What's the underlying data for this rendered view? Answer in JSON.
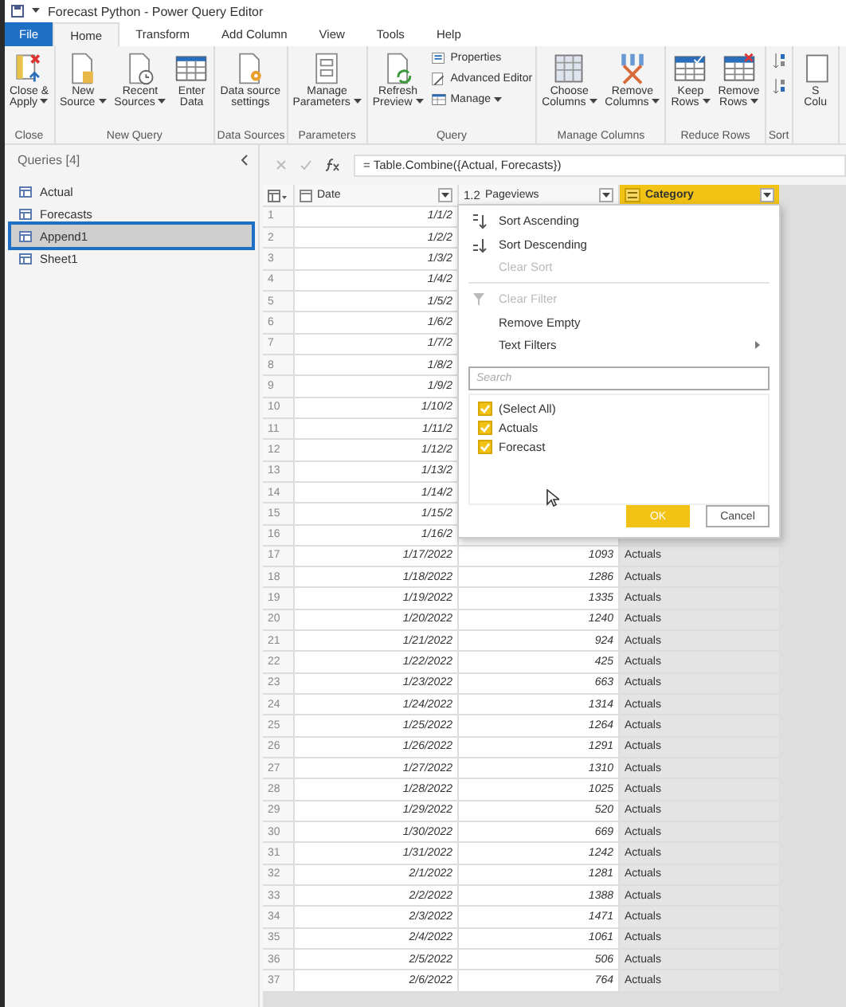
{
  "window": {
    "title": "Forecast Python - Power Query Editor"
  },
  "tabs": [
    {
      "label": "File",
      "kind": "file",
      "selected": false
    },
    {
      "label": "Home",
      "kind": "tab",
      "selected": true
    },
    {
      "label": "Transform",
      "kind": "tab",
      "selected": false
    },
    {
      "label": "Add Column",
      "kind": "tab",
      "selected": false
    },
    {
      "label": "View",
      "kind": "tab",
      "selected": false
    },
    {
      "label": "Tools",
      "kind": "tab",
      "selected": false
    },
    {
      "label": "Help",
      "kind": "tab",
      "selected": false
    }
  ],
  "ribbon": [
    {
      "group": "Close",
      "buttons": [
        {
          "kind": "large",
          "label": "Close &\nApply",
          "dropdown": true
        }
      ]
    },
    {
      "group": "New Query",
      "buttons": [
        {
          "kind": "large",
          "label": "New\nSource",
          "dropdown": true
        },
        {
          "kind": "large",
          "label": "Recent\nSources",
          "dropdown": true
        },
        {
          "kind": "large",
          "label": "Enter\nData",
          "dropdown": false
        }
      ]
    },
    {
      "group": "Data Sources",
      "buttons": [
        {
          "kind": "large",
          "label": "Data source\nsettings",
          "dropdown": false
        }
      ]
    },
    {
      "group": "Parameters",
      "buttons": [
        {
          "kind": "large",
          "label": "Manage\nParameters",
          "dropdown": true
        }
      ]
    },
    {
      "group": "Query",
      "buttons": [
        {
          "kind": "large",
          "label": "Refresh\nPreview",
          "dropdown": true
        },
        {
          "kind": "small",
          "label": "Properties",
          "dropdown": false
        },
        {
          "kind": "small",
          "label": "Advanced Editor",
          "dropdown": false
        },
        {
          "kind": "small",
          "label": "Manage",
          "dropdown": true
        }
      ]
    },
    {
      "group": "Manage Columns",
      "buttons": [
        {
          "kind": "large",
          "label": "Choose\nColumns",
          "dropdown": true
        },
        {
          "kind": "large",
          "label": "Remove\nColumns",
          "dropdown": true
        }
      ]
    },
    {
      "group": "Reduce Rows",
      "buttons": [
        {
          "kind": "large",
          "label": "Keep\nRows",
          "dropdown": true
        },
        {
          "kind": "large",
          "label": "Remove\nRows",
          "dropdown": true
        }
      ]
    },
    {
      "group": "Sort",
      "buttons": [
        {
          "kind": "icon"
        },
        {
          "kind": "icon"
        }
      ]
    },
    {
      "buttons": [
        {
          "kind": "large",
          "label": "S\nColu",
          "dropdown": false
        }
      ]
    }
  ],
  "queries": {
    "title": "Queries [4]",
    "items": [
      {
        "label": "Actual",
        "selected": false
      },
      {
        "label": "Forecasts",
        "selected": false
      },
      {
        "label": "Append1",
        "selected": true
      },
      {
        "label": "Sheet1",
        "selected": false
      }
    ]
  },
  "formula": {
    "text": "= Table.Combine({Actual, Forecasts})"
  },
  "grid": {
    "columns": [
      {
        "label": "Date",
        "kind": "date",
        "selected": false
      },
      {
        "label": "Pageviews",
        "kind": "number",
        "type": "1.2",
        "selected": false
      },
      {
        "label": "Category",
        "kind": "text",
        "selected": true
      }
    ],
    "rows": [
      {
        "n": "1",
        "date": "1/1/2"
      },
      {
        "n": "2",
        "date": "1/2/2"
      },
      {
        "n": "3",
        "date": "1/3/2"
      },
      {
        "n": "4",
        "date": "1/4/2"
      },
      {
        "n": "5",
        "date": "1/5/2"
      },
      {
        "n": "6",
        "date": "1/6/2"
      },
      {
        "n": "7",
        "date": "1/7/2"
      },
      {
        "n": "8",
        "date": "1/8/2"
      },
      {
        "n": "9",
        "date": "1/9/2"
      },
      {
        "n": "10",
        "date": "1/10/2"
      },
      {
        "n": "11",
        "date": "1/11/2"
      },
      {
        "n": "12",
        "date": "1/12/2"
      },
      {
        "n": "13",
        "date": "1/13/2"
      },
      {
        "n": "14",
        "date": "1/14/2"
      },
      {
        "n": "15",
        "date": "1/15/2"
      },
      {
        "n": "16",
        "date": "1/16/2"
      },
      {
        "n": "17",
        "date": "1/17/2022",
        "pageviews": "1093",
        "category": "Actuals"
      },
      {
        "n": "18",
        "date": "1/18/2022",
        "pageviews": "1286",
        "category": "Actuals"
      },
      {
        "n": "19",
        "date": "1/19/2022",
        "pageviews": "1335",
        "category": "Actuals"
      },
      {
        "n": "20",
        "date": "1/20/2022",
        "pageviews": "1240",
        "category": "Actuals"
      },
      {
        "n": "21",
        "date": "1/21/2022",
        "pageviews": "924",
        "category": "Actuals"
      },
      {
        "n": "22",
        "date": "1/22/2022",
        "pageviews": "425",
        "category": "Actuals"
      },
      {
        "n": "23",
        "date": "1/23/2022",
        "pageviews": "663",
        "category": "Actuals"
      },
      {
        "n": "24",
        "date": "1/24/2022",
        "pageviews": "1314",
        "category": "Actuals"
      },
      {
        "n": "25",
        "date": "1/25/2022",
        "pageviews": "1264",
        "category": "Actuals"
      },
      {
        "n": "26",
        "date": "1/26/2022",
        "pageviews": "1291",
        "category": "Actuals"
      },
      {
        "n": "27",
        "date": "1/27/2022",
        "pageviews": "1310",
        "category": "Actuals"
      },
      {
        "n": "28",
        "date": "1/28/2022",
        "pageviews": "1025",
        "category": "Actuals"
      },
      {
        "n": "29",
        "date": "1/29/2022",
        "pageviews": "520",
        "category": "Actuals"
      },
      {
        "n": "30",
        "date": "1/30/2022",
        "pageviews": "669",
        "category": "Actuals"
      },
      {
        "n": "31",
        "date": "1/31/2022",
        "pageviews": "1242",
        "category": "Actuals"
      },
      {
        "n": "32",
        "date": "2/1/2022",
        "pageviews": "1281",
        "category": "Actuals"
      },
      {
        "n": "33",
        "date": "2/2/2022",
        "pageviews": "1388",
        "category": "Actuals"
      },
      {
        "n": "34",
        "date": "2/3/2022",
        "pageviews": "1471",
        "category": "Actuals"
      },
      {
        "n": "35",
        "date": "2/4/2022",
        "pageviews": "1061",
        "category": "Actuals"
      },
      {
        "n": "36",
        "date": "2/5/2022",
        "pageviews": "506",
        "category": "Actuals"
      },
      {
        "n": "37",
        "date": "2/6/2022",
        "pageviews": "764",
        "category": "Actuals"
      }
    ]
  },
  "filter_menu": {
    "items": [
      {
        "label": "Sort Ascending",
        "kind": "sort-asc",
        "disabled": false
      },
      {
        "label": "Sort Descending",
        "kind": "sort-desc",
        "disabled": false
      },
      {
        "label": "Clear Sort",
        "kind": "plain",
        "disabled": true
      },
      {
        "kind": "separator"
      },
      {
        "label": "Clear Filter",
        "kind": "clear-filter",
        "disabled": true
      },
      {
        "label": "Remove Empty",
        "kind": "plain",
        "disabled": false
      },
      {
        "label": "Text Filters",
        "kind": "submenu",
        "disabled": false
      }
    ],
    "search": {
      "placeholder": "Search"
    },
    "values": [
      {
        "label": "(Select All)",
        "checked": true
      },
      {
        "label": "Actuals",
        "checked": true
      },
      {
        "label": "Forecast",
        "checked": true
      }
    ],
    "buttons": [
      {
        "label": "OK",
        "kind": "primary"
      },
      {
        "label": "Cancel",
        "kind": "secondary"
      }
    ]
  }
}
